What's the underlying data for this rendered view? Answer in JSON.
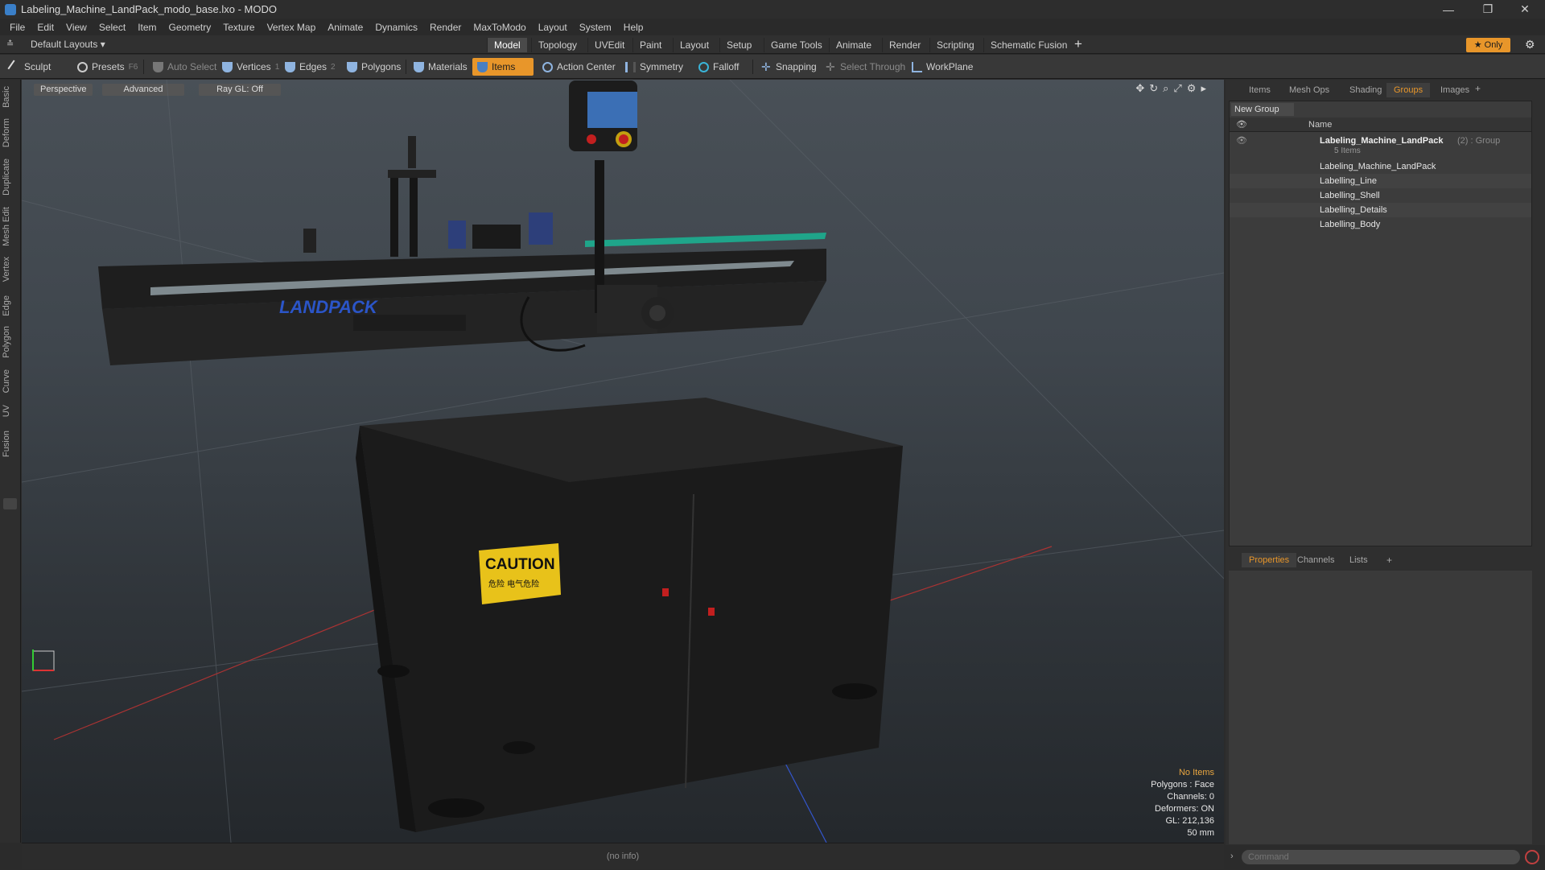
{
  "window": {
    "title": "Labeling_Machine_LandPack_modo_base.lxo - MODO",
    "controls": [
      "—",
      "❐",
      "✕"
    ]
  },
  "menu": [
    "File",
    "Edit",
    "View",
    "Select",
    "Item",
    "Geometry",
    "Texture",
    "Vertex Map",
    "Animate",
    "Dynamics",
    "Render",
    "MaxToModo",
    "Layout",
    "System",
    "Help"
  ],
  "layout_bar": {
    "layout_selector": "Default Layouts ▾",
    "tabs": [
      "Model",
      "Topology",
      "UVEdit",
      "Paint",
      "Layout",
      "Setup",
      "Game Tools",
      "Animate",
      "Render",
      "Scripting",
      "Schematic Fusion"
    ],
    "active_tab": "Model",
    "add_label": "+",
    "only_label": "★  Only"
  },
  "toolbar": {
    "sculpt": "Sculpt",
    "presets": "Presets",
    "presets_key": "F6",
    "auto_select": "Auto Select",
    "vertices": "Vertices",
    "vertices_key": "1",
    "edges": "Edges",
    "edges_key": "2",
    "polygons": "Polygons",
    "materials": "Materials",
    "items": "Items",
    "action_center": "Action Center",
    "symmetry": "Symmetry",
    "falloff": "Falloff",
    "snapping": "Snapping",
    "select_through": "Select Through",
    "workplane": "WorkPlane"
  },
  "left_tabs": [
    "Basic",
    "Deform",
    "Duplicate",
    "Mesh Edit",
    "Vertex",
    "Edge",
    "Polygon",
    "Curve",
    "UV",
    "Fusion"
  ],
  "viewport": {
    "view_mode": "Perspective",
    "shading": "Advanced",
    "raygl": "Ray GL: Off",
    "hud": {
      "selection": "No Items",
      "polygons": "Polygons : Face",
      "channels": "Channels: 0",
      "deformers": "Deformers: ON",
      "gl": "GL: 212,136",
      "focal": "50 mm"
    },
    "brand_text": "LANDPACK",
    "caution_title": "CAUTION",
    "caution_sub": "危险 电气危险"
  },
  "status_bar": {
    "info": "(no info)"
  },
  "right_panel": {
    "top_tabs": [
      "Items",
      "Mesh Ops",
      "Shading",
      "Groups",
      "Images"
    ],
    "active_top_tab": "Groups",
    "new_group": "New Group",
    "column_name": "Name",
    "group": {
      "name": "Labeling_Machine_LandPack",
      "suffix": " (2) : Group",
      "count": "5 Items"
    },
    "children": [
      "Labeling_Machine_LandPack",
      "Labelling_Line",
      "Labelling_Shell",
      "Labelling_Details",
      "Labelling_Body"
    ],
    "bottom_tabs": [
      "Properties",
      "Channels",
      "Lists"
    ],
    "active_bottom_tab": "Properties",
    "command_placeholder": "Command"
  },
  "colors": {
    "accent": "#e8962a",
    "viewport_top": "#495057",
    "viewport_bottom": "#24282c"
  }
}
